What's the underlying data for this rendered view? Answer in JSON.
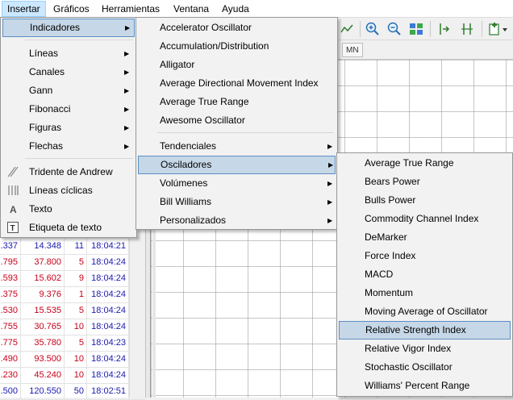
{
  "menubar": {
    "items": [
      {
        "label": "Insertar",
        "active": true
      },
      {
        "label": "Gráficos"
      },
      {
        "label": "Herramientas"
      },
      {
        "label": "Ventana"
      },
      {
        "label": "Ayuda"
      }
    ]
  },
  "timeframe": {
    "mn_label": "MN"
  },
  "insert_menu": {
    "items": [
      {
        "label": "Indicadores",
        "submenu": true,
        "highlighted": true
      },
      {
        "label": "Líneas",
        "submenu": true
      },
      {
        "label": "Canales",
        "submenu": true
      },
      {
        "label": "Gann",
        "submenu": true
      },
      {
        "label": "Fibonacci",
        "submenu": true
      },
      {
        "label": "Figuras",
        "submenu": true
      },
      {
        "label": "Flechas",
        "submenu": true
      },
      {
        "label": "Tridente de Andrew",
        "icon": "andrews-pitchfork-icon"
      },
      {
        "label": "Líneas cíclicas",
        "icon": "cycle-lines-icon"
      },
      {
        "label": "Texto",
        "icon": "text-icon"
      },
      {
        "label": "Etiqueta de texto",
        "icon": "text-label-icon"
      }
    ]
  },
  "indicators_menu": {
    "items": [
      {
        "label": "Accelerator Oscillator"
      },
      {
        "label": "Accumulation/Distribution"
      },
      {
        "label": "Alligator"
      },
      {
        "label": "Average Directional Movement Index"
      },
      {
        "label": "Average True Range"
      },
      {
        "label": "Awesome Oscillator"
      },
      {
        "label": "Tendenciales",
        "submenu": true
      },
      {
        "label": "Osciladores",
        "submenu": true,
        "highlighted": true
      },
      {
        "label": "Volúmenes",
        "submenu": true
      },
      {
        "label": "Bill Williams",
        "submenu": true
      },
      {
        "label": "Personalizados",
        "submenu": true
      }
    ]
  },
  "oscillators_menu": {
    "items": [
      {
        "label": "Average True Range"
      },
      {
        "label": "Bears Power"
      },
      {
        "label": "Bulls Power"
      },
      {
        "label": "Commodity Channel Index"
      },
      {
        "label": "DeMarker"
      },
      {
        "label": "Force Index"
      },
      {
        "label": "MACD"
      },
      {
        "label": "Momentum"
      },
      {
        "label": "Moving Average of Oscillator"
      },
      {
        "label": "Relative Strength Index",
        "highlighted": true
      },
      {
        "label": "Relative Vigor Index"
      },
      {
        "label": "Stochastic Oscillator"
      },
      {
        "label": "Williams' Percent Range"
      }
    ]
  },
  "quotes": {
    "rows": [
      {
        "bid": ".337",
        "ask": "14.348",
        "spread": "11",
        "time": "18:04:21",
        "color": "#1a1ab0"
      },
      {
        "bid": ".795",
        "ask": "37.800",
        "spread": "5",
        "time": "18:04:24",
        "color": "#c8001a"
      },
      {
        "bid": ".593",
        "ask": "15.602",
        "spread": "9",
        "time": "18:04:24",
        "color": "#c8001a"
      },
      {
        "bid": ".375",
        "ask": "9.376",
        "spread": "1",
        "time": "18:04:24",
        "color": "#c8001a"
      },
      {
        "bid": ".530",
        "ask": "15.535",
        "spread": "5",
        "time": "18:04:24",
        "color": "#c8001a"
      },
      {
        "bid": ".755",
        "ask": "30.765",
        "spread": "10",
        "time": "18:04:24",
        "color": "#c8001a"
      },
      {
        "bid": ".775",
        "ask": "35.780",
        "spread": "5",
        "time": "18:04:23",
        "color": "#c8001a"
      },
      {
        "bid": ".490",
        "ask": "93.500",
        "spread": "10",
        "time": "18:04:24",
        "color": "#c8001a"
      },
      {
        "bid": ".230",
        "ask": "45.240",
        "spread": "10",
        "time": "18:04:24",
        "color": "#c8001a"
      },
      {
        "bid": ".500",
        "ask": "120.550",
        "spread": "50",
        "time": "18:02:51",
        "color": "#1a1ab0"
      }
    ]
  }
}
